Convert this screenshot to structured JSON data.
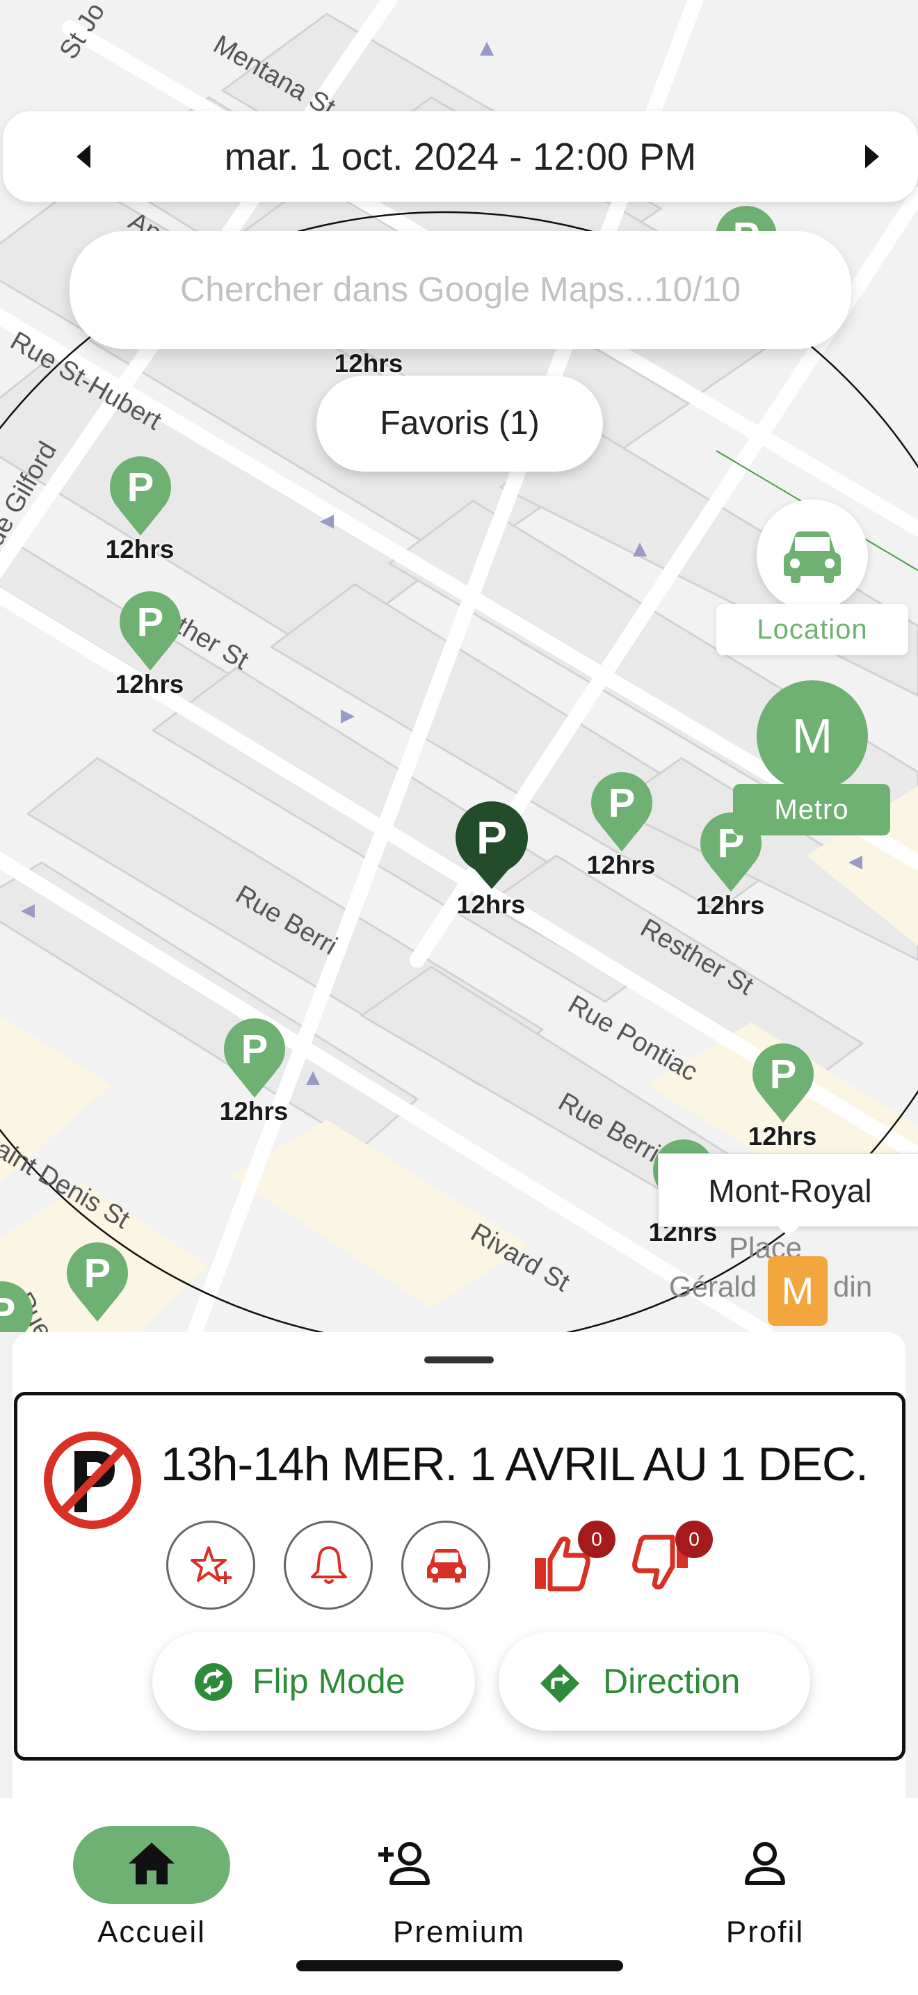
{
  "date_bar": {
    "prev_icon": "caret-left-icon",
    "next_icon": "caret-right-icon",
    "date_text": "mar. 1 oct. 2024 - 12:00 PM"
  },
  "search": {
    "placeholder": "Chercher dans Google Maps...10/10",
    "value": ""
  },
  "favoris": {
    "label": "Favoris (1)"
  },
  "location_fab": {
    "icon": "car-icon",
    "label": "Location"
  },
  "metro_fab": {
    "letter": "M",
    "label": "Metro"
  },
  "map": {
    "pin_letter": "P",
    "streets": {
      "mentana": "Mentana St",
      "st_jo": "St Jo",
      "st_hubert": "Rue St-Hubert",
      "gilford": "ue Gilford",
      "resther_1": "Resther St",
      "resther_2": "Resther St",
      "berri_1": "Rue Berri",
      "berri_2": "Rue Berri",
      "pontiac": "Rue Pontiac",
      "rivard": "Rivard St",
      "saint_denis": "aint Denis St",
      "gilford_2": "Rue Gil",
      "andre": "And",
      "place": "Place",
      "gerald": "Gérald",
      "godin": "din"
    },
    "pins": [
      {
        "label": "12hrs"
      },
      {
        "label": "12hrs"
      },
      {
        "label": "12hrs"
      },
      {
        "label": "12hrs"
      },
      {
        "label": "12hrs"
      },
      {
        "label": "12hrs"
      },
      {
        "label": "12hrs"
      },
      {
        "label": "12hrs"
      },
      {
        "label": "12hrs"
      },
      {
        "label": "12hrs"
      },
      {
        "label": "12hrs"
      }
    ],
    "mont_royal_label": "Mont-Royal",
    "metro_station_letter": "M"
  },
  "sheet": {
    "rule_text": "13h-14h MER. 1 AVRIL AU 1 DEC.",
    "sign_icon": "no-parking-icon",
    "actions": {
      "favorite_icon": "star-plus-icon",
      "alert_icon": "bell-icon",
      "car_icon": "car-icon",
      "thumbs_up_icon": "thumbs-up-icon",
      "thumbs_down_icon": "thumbs-down-icon",
      "thumbs_up_count": "0",
      "thumbs_down_count": "0"
    },
    "flip_mode": {
      "icon": "refresh-icon",
      "label": "Flip Mode"
    },
    "direction": {
      "icon": "direction-icon",
      "label": "Direction"
    }
  },
  "nav": {
    "items": [
      {
        "label": "Accueil",
        "icon": "home-icon",
        "active": true
      },
      {
        "label": "Premium",
        "icon": "person-add-icon",
        "active": false
      },
      {
        "label": "Profil",
        "icon": "person-icon",
        "active": false
      }
    ]
  },
  "colors": {
    "accent_green": "#6fb173",
    "dark_green": "#234d2a",
    "button_green": "#2e8b3a",
    "alert_red": "#d93025",
    "badge_red": "#a51a1a",
    "metro_orange": "#f3a63d"
  }
}
